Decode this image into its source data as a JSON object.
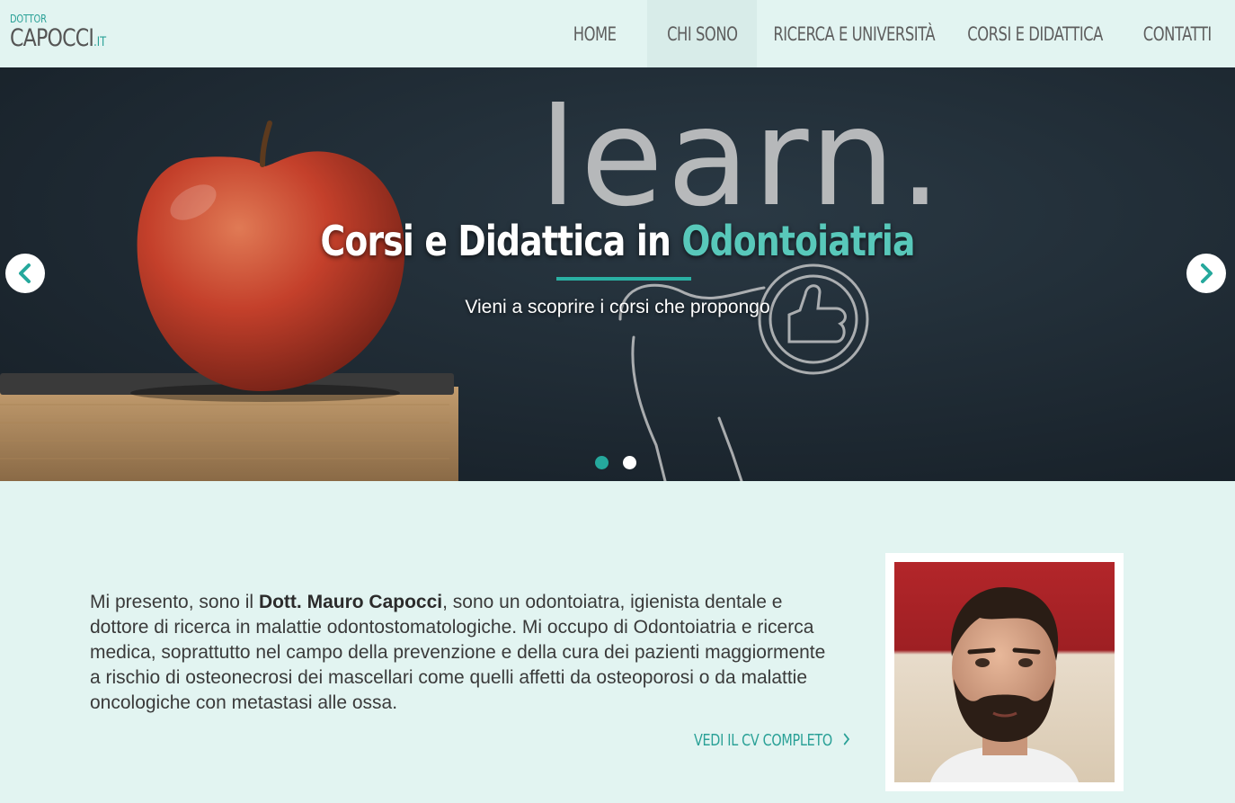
{
  "logo": {
    "top": "DOTTOR",
    "main": "CAPOCCI",
    "tld": ".IT"
  },
  "nav": [
    {
      "label": "HOME"
    },
    {
      "label": "CHI SONO"
    },
    {
      "label": "RICERCA E UNIVERSITÀ"
    },
    {
      "label": "CORSI E DIDATTICA"
    },
    {
      "label": "CONTATTI"
    }
  ],
  "hero": {
    "title_main": "Corsi e Didattica in",
    "title_accent": "Odontoiatria",
    "subtitle": "Vieni a scoprire i corsi che propongo",
    "chalk_word": "learn.",
    "active_slide": 1,
    "slide_count": 2
  },
  "about": {
    "intro": "Mi presento, sono il ",
    "name": "Dott. Mauro Capocci",
    "rest": ", sono un odontoiatra, igienista dentale e dottore di ricerca in malattie odontostomatologiche. Mi occupo di Odontoiatria e ricerca medica, soprattutto nel campo della prevenzione e della cura dei pazienti maggiormente a rischio di osteonecrosi dei mascellari come quelli affetti da osteoporosi o da malattie oncologiche con metastasi alle ossa.",
    "cv_link": "VEDI IL CV COMPLETO"
  },
  "colors": {
    "accent": "#2aa197",
    "background": "#e2f4f1",
    "hero_accent": "#58c8ba"
  },
  "icons": {
    "prev": "chevron-left-icon",
    "next": "chevron-right-icon",
    "cv": "chevron-right-icon"
  }
}
